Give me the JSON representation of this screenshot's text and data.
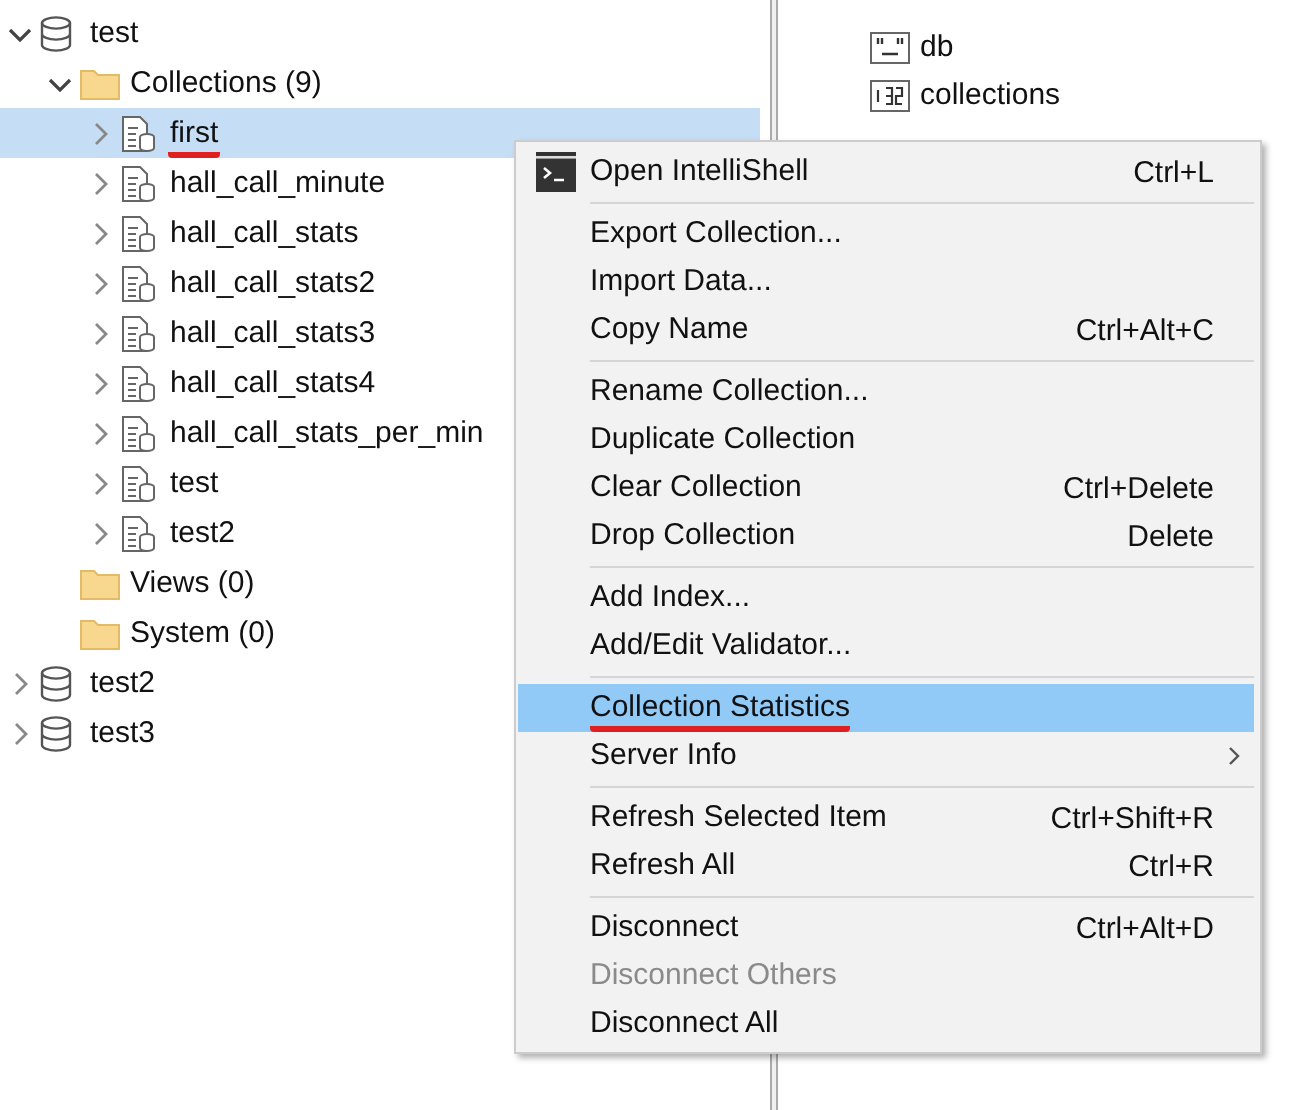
{
  "tree": [
    {
      "label": "test",
      "kind": "database",
      "expandable": true,
      "expanded": true,
      "selected": false,
      "underlined": false,
      "children": [
        {
          "label": "Collections (9)",
          "kind": "folder",
          "expandable": true,
          "expanded": true,
          "selected": false,
          "underlined": false,
          "children": [
            {
              "label": "first",
              "kind": "collection",
              "expandable": true,
              "expanded": false,
              "selected": true,
              "underlined": true
            },
            {
              "label": "hall_call_minute",
              "kind": "collection",
              "expandable": true,
              "expanded": false,
              "selected": false,
              "underlined": false
            },
            {
              "label": "hall_call_stats",
              "kind": "collection",
              "expandable": true,
              "expanded": false,
              "selected": false,
              "underlined": false
            },
            {
              "label": "hall_call_stats2",
              "kind": "collection",
              "expandable": true,
              "expanded": false,
              "selected": false,
              "underlined": false
            },
            {
              "label": "hall_call_stats3",
              "kind": "collection",
              "expandable": true,
              "expanded": false,
              "selected": false,
              "underlined": false
            },
            {
              "label": "hall_call_stats4",
              "kind": "collection",
              "expandable": true,
              "expanded": false,
              "selected": false,
              "underlined": false
            },
            {
              "label": "hall_call_stats_per_min",
              "kind": "collection",
              "expandable": true,
              "expanded": false,
              "selected": false,
              "underlined": false
            },
            {
              "label": "test",
              "kind": "collection",
              "expandable": true,
              "expanded": false,
              "selected": false,
              "underlined": false
            },
            {
              "label": "test2",
              "kind": "collection",
              "expandable": true,
              "expanded": false,
              "selected": false,
              "underlined": false
            }
          ]
        },
        {
          "label": "Views (0)",
          "kind": "folder",
          "expandable": false,
          "selected": false,
          "underlined": false
        },
        {
          "label": "System (0)",
          "kind": "folder",
          "expandable": false,
          "selected": false,
          "underlined": false
        }
      ]
    },
    {
      "label": "test2",
      "kind": "database",
      "expandable": true,
      "expanded": false,
      "selected": false,
      "underlined": false
    },
    {
      "label": "test3",
      "kind": "database",
      "expandable": true,
      "expanded": false,
      "selected": false,
      "underlined": false
    }
  ],
  "fields": [
    {
      "name": "db",
      "kind": "string"
    },
    {
      "name": "collections",
      "kind": "int32"
    }
  ],
  "context_menu": [
    {
      "kind": "shell",
      "label": "Open IntelliShell",
      "shortcut": "Ctrl+L",
      "disabled": false,
      "selected": false,
      "underlined": false,
      "submenu": false
    },
    {
      "kind": "separator"
    },
    {
      "kind": "item",
      "label": "Export Collection...",
      "disabled": false,
      "selected": false,
      "underlined": false,
      "submenu": false
    },
    {
      "kind": "item",
      "label": "Import Data...",
      "disabled": false,
      "selected": false,
      "underlined": false,
      "submenu": false
    },
    {
      "kind": "item",
      "label": "Copy Name",
      "shortcut": "Ctrl+Alt+C",
      "disabled": false,
      "selected": false,
      "underlined": false,
      "submenu": false
    },
    {
      "kind": "separator"
    },
    {
      "kind": "item",
      "label": "Rename Collection...",
      "disabled": false,
      "selected": false,
      "underlined": false,
      "submenu": false
    },
    {
      "kind": "item",
      "label": "Duplicate Collection",
      "disabled": false,
      "selected": false,
      "underlined": false,
      "submenu": false
    },
    {
      "kind": "item",
      "label": "Clear Collection",
      "shortcut": "Ctrl+Delete",
      "disabled": false,
      "selected": false,
      "underlined": false,
      "submenu": false
    },
    {
      "kind": "item",
      "label": "Drop Collection",
      "shortcut": "Delete",
      "disabled": false,
      "selected": false,
      "underlined": false,
      "submenu": false
    },
    {
      "kind": "separator"
    },
    {
      "kind": "item",
      "label": "Add Index...",
      "disabled": false,
      "selected": false,
      "underlined": false,
      "submenu": false
    },
    {
      "kind": "item",
      "label": "Add/Edit Validator...",
      "disabled": false,
      "selected": false,
      "underlined": false,
      "submenu": false
    },
    {
      "kind": "separator"
    },
    {
      "kind": "item",
      "label": "Collection Statistics",
      "disabled": false,
      "selected": true,
      "underlined": true,
      "submenu": false
    },
    {
      "kind": "item",
      "label": "Server Info",
      "disabled": false,
      "selected": false,
      "underlined": false,
      "submenu": true
    },
    {
      "kind": "separator"
    },
    {
      "kind": "item",
      "label": "Refresh Selected Item",
      "shortcut": "Ctrl+Shift+R",
      "disabled": false,
      "selected": false,
      "underlined": false,
      "submenu": false
    },
    {
      "kind": "item",
      "label": "Refresh All",
      "shortcut": "Ctrl+R",
      "disabled": false,
      "selected": false,
      "underlined": false,
      "submenu": false
    },
    {
      "kind": "separator"
    },
    {
      "kind": "item",
      "label": "Disconnect",
      "shortcut": "Ctrl+Alt+D",
      "disabled": false,
      "selected": false,
      "underlined": false,
      "submenu": false
    },
    {
      "kind": "item",
      "label": "Disconnect Others",
      "disabled": true,
      "selected": false,
      "underlined": false,
      "submenu": false
    },
    {
      "kind": "item",
      "label": "Disconnect All",
      "disabled": false,
      "selected": false,
      "underlined": false,
      "submenu": false
    }
  ]
}
